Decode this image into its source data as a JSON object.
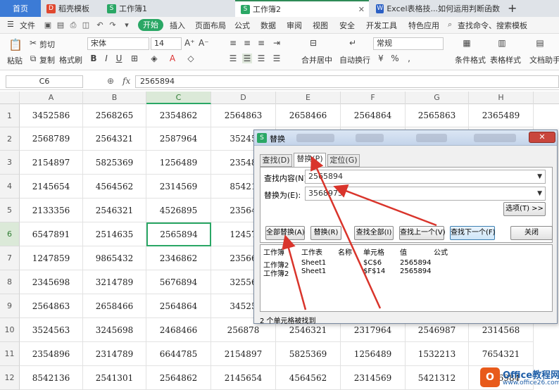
{
  "titlebar": {
    "tabs": [
      {
        "label": "首页",
        "icon": ""
      },
      {
        "label": "稻壳模板",
        "icon": "docer-icon"
      },
      {
        "label": "工作簿1",
        "icon": "sheet-icon"
      },
      {
        "label": "工作簿2",
        "icon": "sheet-icon"
      },
      {
        "label": "Excel表格技...如何运用判断函数",
        "icon": "word-icon"
      }
    ],
    "new_tab": "+"
  },
  "menubar": {
    "file": "文件",
    "start": "开始",
    "items": [
      "插入",
      "页面布局",
      "公式",
      "数据",
      "审阅",
      "视图",
      "安全",
      "开发工具",
      "特色应用"
    ],
    "search": "查找命令、搜索模板"
  },
  "ribbon": {
    "paste": "粘贴",
    "cut": "剪切",
    "copy": "复制",
    "format_painter": "格式刷",
    "font": "宋体",
    "font_size": "14",
    "merge": "合并居中",
    "wrap": "自动换行",
    "number_format": "常规",
    "conditional": "条件格式",
    "table_style": "表格样式",
    "doc_helper": "文档助手",
    "bold": "B",
    "italic": "I",
    "underline": "U"
  },
  "formulabar": {
    "namebox": "C6",
    "fx": "fx",
    "value": "2565894"
  },
  "grid": {
    "columns": [
      "A",
      "B",
      "C",
      "D",
      "E",
      "F",
      "G",
      "H"
    ],
    "rows": [
      "1",
      "2",
      "3",
      "4",
      "5",
      "6",
      "7",
      "8",
      "9",
      "10",
      "11",
      "12"
    ],
    "selected_cell": "C6",
    "data": [
      [
        "3452586",
        "2568265",
        "2354862",
        "2564863",
        "2658466",
        "2564864",
        "2565863",
        "2365489"
      ],
      [
        "2568789",
        "2564321",
        "2587964",
        "35245",
        "",
        "",
        "",
        ""
      ],
      [
        "2154897",
        "5825369",
        "1256489",
        "23548",
        "",
        "",
        "",
        ""
      ],
      [
        "2145654",
        "4564562",
        "2314569",
        "85421",
        "",
        "",
        "",
        ""
      ],
      [
        "2133356",
        "2546321",
        "4526895",
        "23564",
        "",
        "",
        "",
        ""
      ],
      [
        "6547891",
        "2514635",
        "2565894",
        "12457",
        "",
        "",
        "",
        ""
      ],
      [
        "1247859",
        "9865432",
        "2346862",
        "23566",
        "",
        "",
        "",
        ""
      ],
      [
        "2345698",
        "3214789",
        "5676894",
        "32556",
        "",
        "",
        "",
        ""
      ],
      [
        "2564863",
        "2658466",
        "2564864",
        "34525",
        "",
        "",
        "",
        ""
      ],
      [
        "3524563",
        "3245698",
        "2468466",
        "256878",
        "2546321",
        "2317964",
        "2546987",
        "2314568"
      ],
      [
        "2354896",
        "2314789",
        "6644785",
        "2154897",
        "5825369",
        "1256489",
        "1532213",
        "7654321"
      ],
      [
        "8542136",
        "2541301",
        "2564862",
        "2145654",
        "4564562",
        "2314569",
        "5421312",
        "2356984"
      ]
    ]
  },
  "dialog": {
    "title": "替换",
    "close": "✕",
    "tabs": [
      "查找(D)",
      "替换(P)",
      "定位(G)"
    ],
    "find_label": "查找内容(N):",
    "find_value": "2565894",
    "replace_label": "替换为(E):",
    "replace_value": "3568975",
    "options_btn": "选项(T) >>",
    "buttons": [
      "全部替换(A)",
      "替换(R)",
      "查找全部(I)",
      "查找上一个(V)",
      "查找下一个(F)",
      "关闭"
    ],
    "result_headers": [
      "工作簿",
      "工作表",
      "名称",
      "单元格",
      "值",
      "公式"
    ],
    "results": [
      [
        "工作簿2",
        "Sheet1",
        "",
        "$C$6",
        "2565894",
        ""
      ],
      [
        "工作簿2",
        "Sheet1",
        "",
        "$F$14",
        "2565894",
        ""
      ]
    ],
    "status": "2 个单元格被找到"
  },
  "watermark": {
    "logo": "O",
    "name": "Office教程网",
    "url": "www.office26.com"
  },
  "colors": {
    "accent": "#2aa765",
    "arrow": "#d9342b",
    "home_tab": "#3c7bd6"
  }
}
